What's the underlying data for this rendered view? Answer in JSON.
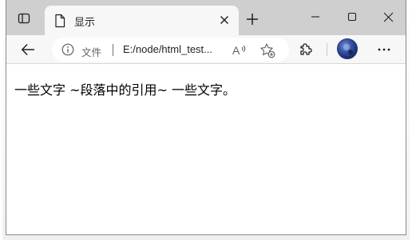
{
  "browser": {
    "tab": {
      "title": "显示"
    },
    "address_bar": {
      "site_label": "文件",
      "url": "E:/node/html_test..."
    }
  },
  "page": {
    "paragraph": {
      "before": "一些文字 ",
      "quote_open": "~",
      "quote": "段落中的引用",
      "quote_close": "~",
      "after": " 一些文字。"
    }
  },
  "icons": {
    "tab_actions": "tab-actions-icon",
    "favicon": "document-icon",
    "tab_close": "close-icon",
    "new_tab": "plus-icon",
    "minimize": "minimize-icon",
    "maximize": "maximize-icon",
    "close_window": "close-icon",
    "back": "arrow-left-icon",
    "info": "info-icon",
    "read_aloud": "read-aloud-icon",
    "add_favorite": "star-plus-icon",
    "extensions": "puzzle-icon",
    "profile": "avatar",
    "more": "more-dots-icon"
  },
  "colors": {
    "titlebar": "#cfcfcf",
    "toolbar": "#f7f7f7",
    "page_background": "#ffffff"
  }
}
